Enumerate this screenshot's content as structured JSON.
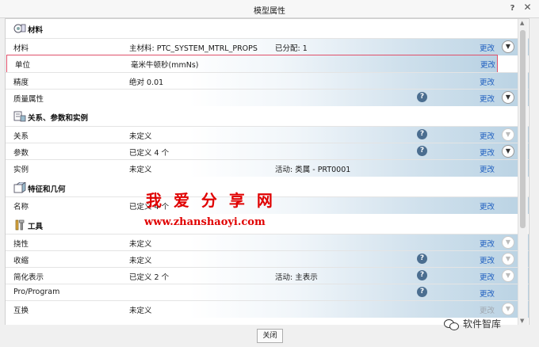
{
  "window": {
    "title": "模型属性",
    "help": "?",
    "close": "✕"
  },
  "sections": [
    {
      "key": "materials",
      "title": "材料",
      "icon": "materials-icon"
    },
    {
      "key": "relations",
      "title": "关系、参数和实例",
      "icon": "relations-icon"
    },
    {
      "key": "features",
      "title": "特征和几何",
      "icon": "features-icon"
    },
    {
      "key": "tools",
      "title": "工具",
      "icon": "tools-icon"
    }
  ],
  "rows": {
    "material": {
      "label": "材料",
      "value": "主材料: PTC_SYSTEM_MTRL_PROPS",
      "value2": "已分配: 1",
      "change": "更改"
    },
    "units": {
      "label": "单位",
      "value": "毫米牛顿秒(mmNs)",
      "change": "更改"
    },
    "accuracy": {
      "label": "精度",
      "value": "绝对 0.01",
      "change": "更改"
    },
    "mass": {
      "label": "质量属性",
      "change": "更改"
    },
    "relations": {
      "label": "关系",
      "value": "未定义",
      "change": "更改"
    },
    "parameters": {
      "label": "参数",
      "value": "已定义 4 个",
      "change": "更改"
    },
    "instances": {
      "label": "实例",
      "value": "未定义",
      "value2": "活动: 类属 - PRT0001",
      "change": "更改"
    },
    "names": {
      "label": "名称",
      "value": "已定义 4 个",
      "change": "更改"
    },
    "flexibility": {
      "label": "挠性",
      "value": "未定义",
      "change": "更改"
    },
    "shrinkage": {
      "label": "收缩",
      "value": "未定义",
      "change": "更改"
    },
    "simplified": {
      "label": "简化表示",
      "value": "已定义 2 个",
      "value2": "活动: 主表示",
      "change": "更改"
    },
    "proprogram": {
      "label": "Pro/Program",
      "change": "更改"
    },
    "interchange": {
      "label": "互换",
      "value": "未定义",
      "change": "更改"
    }
  },
  "footer": {
    "close_label": "关闭"
  },
  "watermark": {
    "line1": "我 爱 分 享 网",
    "line2": "www.zhanshaoyi.com",
    "brand": "软件智库"
  },
  "colors": {
    "link": "#2060c0",
    "highlight_border": "#e0506a",
    "help_icon": "#4b6e90",
    "watermark": "#e00000"
  }
}
